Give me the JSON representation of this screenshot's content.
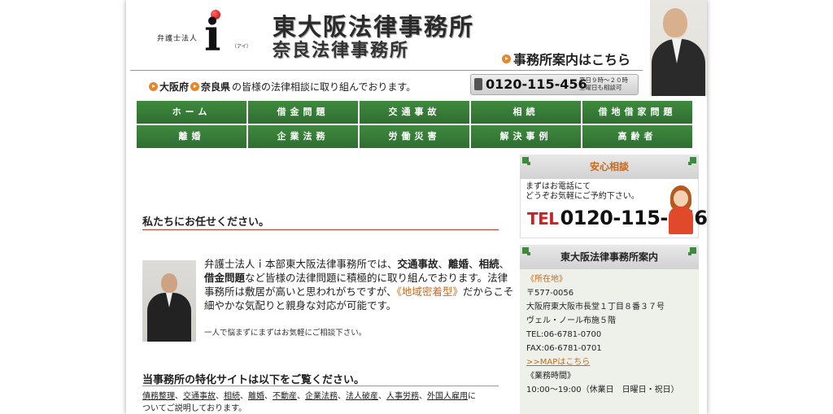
{
  "header": {
    "logo_label": "弁護士法人",
    "logo_letter": "i",
    "logo_kana": "（アイ）",
    "title_main": "東大阪法律事務所",
    "title_sub": "奈良法律事務所",
    "office_link": "事務所案内はこちら",
    "tagline_region1": "大阪府",
    "tagline_region2": "奈良県",
    "tagline_text": "の皆様の法律相談に取り組んでおります。",
    "tel": "0120-115-456",
    "hours_line1": "平日９時～２０時",
    "hours_line2": "土曜日も相談可"
  },
  "nav": {
    "row1": [
      "ホーム",
      "借金問題",
      "交通事故",
      "相続",
      "借地借家問題"
    ],
    "row2": [
      "離婚",
      "企業法務",
      "労働災害",
      "解決事例",
      "高齢者"
    ]
  },
  "main": {
    "heading1": "私たちにお任せください。",
    "intro_a": "弁護士法人ｉ本部東大阪法律事務所では、",
    "intro_b1": "交通事故",
    "intro_sep1": "、",
    "intro_b2": "離婚",
    "intro_sep2": "、",
    "intro_b3": "相続",
    "intro_sep3": "、",
    "intro_b4": "借金問題",
    "intro_c": "など皆様の法律問題に積極的に取り組んでおります。法律事務所は敷居が高いと思われがちですが、",
    "intro_hl": "《地域密着型》",
    "intro_d": "だからこそ細やかな気配りと親身な対応が可能です。",
    "intro_small": "一人で悩まずにまずはお気軽にご相談下さい。",
    "heading2": "当事務所の特化サイトは以下をご覧ください。",
    "links": [
      "債務整理",
      "交通事故",
      "相続",
      "離婚",
      "不動産",
      "企業法務",
      "法人破産",
      "人事労務",
      "外国人雇用"
    ],
    "links_sep": "、",
    "links_tail1": "に",
    "links_tail2": "ついてご説明しております。"
  },
  "sidebar": {
    "consult_title": "安心相談",
    "consult_line1": "まずはお電話にて",
    "consult_line2": "どうぞお気軽にご予約下さい。",
    "tel_mark": "TEL",
    "tel": "0120-115-456",
    "office_title": "東大阪法律事務所案内",
    "location_label": "《所在地》",
    "postal": "〒577-0056",
    "address1": "大阪府東大阪市長堂１丁目８番３７号",
    "address2": "ヴェル・ノール布施５階",
    "tel_line": "TEL:06-6781-0700",
    "fax_line": "FAX:06-6781-0701",
    "map_link": ">>MAPはこちら",
    "hours_label": "《業務時間》",
    "hours": "10:00～19:00（休業日　日曜日・祝日）"
  },
  "colors": {
    "nav_green": "#2f6e30",
    "accent_orange": "#c86a1a",
    "heading_rule": "#c0392b",
    "tel_red": "#cc2222"
  }
}
